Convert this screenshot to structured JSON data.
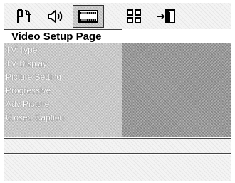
{
  "tabs": [
    {
      "name": "general-setup",
      "icon": "tools-icon",
      "active": false
    },
    {
      "name": "audio-setup",
      "icon": "speaker-icon",
      "active": false
    },
    {
      "name": "video-setup",
      "icon": "film-icon",
      "active": true
    },
    {
      "name": "preference",
      "icon": "grid-icon",
      "active": false
    },
    {
      "name": "exit",
      "icon": "exit-door-icon",
      "active": false
    }
  ],
  "page_title": "Video Setup Page",
  "menu": {
    "items": [
      {
        "label": "TV Type"
      },
      {
        "label": "TV Display"
      },
      {
        "label": "Picture Setting"
      },
      {
        "label": "Progressive"
      },
      {
        "label": "Adv Picture"
      },
      {
        "label": "Closed Caption"
      }
    ]
  },
  "colors": {
    "menu_bg": "#c9c9c9",
    "submenu_bg": "#9a9a9a",
    "text_white": "#ffffff",
    "border": "#444444"
  }
}
